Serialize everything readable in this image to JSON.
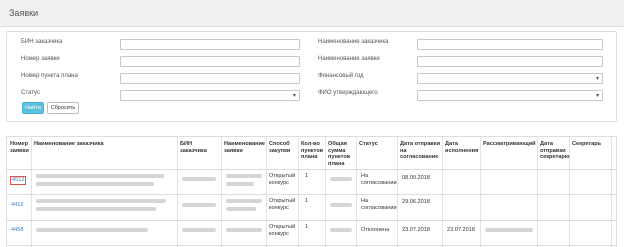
{
  "page": {
    "title": "Заявки"
  },
  "filters": {
    "customer_bin_label": "БИН заказчика",
    "customer_name_label": "Наименование заказчика",
    "request_number_label": "Номер заявки",
    "request_name_label": "Наименование заявки",
    "plan_item_number_label": "Номер пункта плана",
    "financial_year_label": "Финансовый год",
    "status_label": "Статус",
    "approver_fio_label": "ФИО утверждающего"
  },
  "buttons": {
    "find": "Найти",
    "reset": "Сбросить"
  },
  "table": {
    "columns": [
      "Номер заявки",
      "Наименование заказчика",
      "БИН заказчика",
      "Наименование заявки",
      "Способ закупки",
      "Кол-во пунктов плана",
      "Общая сумма пунктов плана",
      "Статус",
      "Дата отправки на согласование",
      "Дата исполнения",
      "Рассматривающий",
      "Дата отправки секретарю",
      "Секретарь"
    ],
    "rows": [
      {
        "number": "4512",
        "method": "Открытый конкурс",
        "count": "1",
        "status": "На согласовании",
        "sent_date": "08.09.2018",
        "exec_date": ""
      },
      {
        "number": "4412",
        "method": "Открытый конкурс",
        "count": "1",
        "status": "На согласовании",
        "sent_date": "29.06.2018",
        "exec_date": ""
      },
      {
        "number": "4458",
        "method": "Открытый конкурс",
        "count": "1",
        "status": "Отклонена",
        "sent_date": "23.07.2018",
        "exec_date": "23.07.2018"
      }
    ]
  },
  "colors": {
    "accent": "#5bc0de",
    "link": "#3a7bbf",
    "highlight_border": "#d9534f"
  }
}
